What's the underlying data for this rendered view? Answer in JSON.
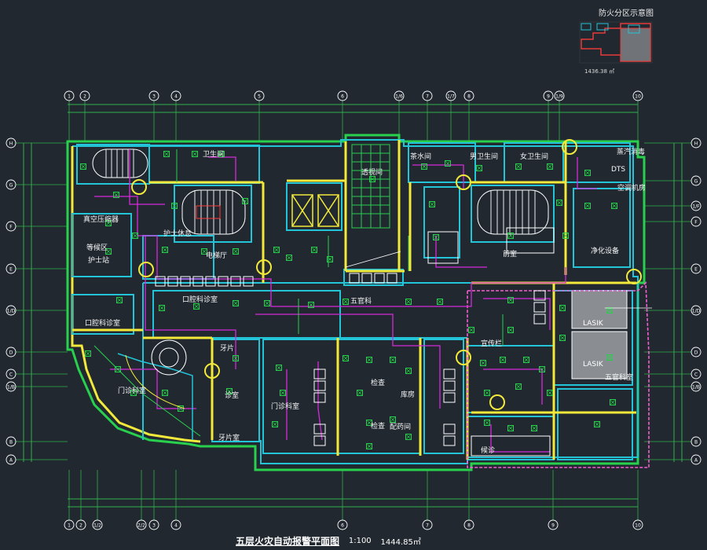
{
  "drawing": {
    "title": "五层火灾自动报警平面图",
    "scale": "1:100",
    "area": "1444.85㎡",
    "accent_colors": {
      "background": "#212830",
      "wall_cyan": "#23c4d8",
      "wall_yellow": "#f2e93a",
      "wire_magenta": "#d52ad9",
      "device_green": "#28d04e",
      "grid_green": "#31b14a",
      "fire_zone_pink": "#f35fd0"
    }
  },
  "inset": {
    "title": "防火分区示意图",
    "area_note": "1436.38 ㎡"
  },
  "grid_axes": {
    "top": [
      "1",
      "2",
      "3",
      "4",
      "5",
      "6",
      "1/6",
      "7",
      "1/7",
      "8",
      "9",
      "1/9",
      "10"
    ],
    "bottom": [
      "1",
      "2",
      "1/2",
      "2/2",
      "3",
      "4",
      "6",
      "7",
      "8",
      "9",
      "10"
    ],
    "left": [
      "H",
      "G",
      "F",
      "E",
      "1/D",
      "D",
      "C",
      "1/B",
      "B",
      "A"
    ],
    "right": [
      "H",
      "G",
      "1/F",
      "F",
      "E",
      "1/D",
      "D",
      "C",
      "1/B",
      "B",
      "A"
    ]
  },
  "rooms": [
    {
      "id": "r1",
      "label": "护士休息"
    },
    {
      "id": "r2",
      "label": "真空压缩器"
    },
    {
      "id": "r3",
      "label": "茶水间"
    },
    {
      "id": "r4",
      "label": "男卫生间"
    },
    {
      "id": "r5",
      "label": "女卫生间"
    },
    {
      "id": "r6",
      "label": "透视间"
    },
    {
      "id": "r7",
      "label": "蒸汽消毒"
    },
    {
      "id": "r8",
      "label": "空调机房"
    },
    {
      "id": "r9",
      "label": "护士站"
    },
    {
      "id": "r10",
      "label": "净化设备"
    },
    {
      "id": "r11",
      "label": "等候区"
    },
    {
      "id": "r12",
      "label": "口腔科诊室"
    },
    {
      "id": "r13",
      "label": "口腔科诊室"
    },
    {
      "id": "r14",
      "label": "五官科"
    },
    {
      "id": "r15",
      "label": "门诊科室"
    },
    {
      "id": "r16",
      "label": "牙片"
    },
    {
      "id": "r17",
      "label": "牙片室"
    },
    {
      "id": "r18",
      "label": "门诊科室"
    },
    {
      "id": "r19",
      "label": "宣传栏"
    },
    {
      "id": "r20",
      "label": "五官科室"
    },
    {
      "id": "r21",
      "label": "卫生间"
    },
    {
      "id": "r22",
      "label": "诊室"
    },
    {
      "id": "r23",
      "label": "LASIK"
    },
    {
      "id": "r24",
      "label": "LASIK"
    },
    {
      "id": "r25",
      "label": "电梯厅"
    },
    {
      "id": "r26",
      "label": "前室"
    },
    {
      "id": "r27",
      "label": "检查"
    },
    {
      "id": "r28",
      "label": "检查"
    },
    {
      "id": "r29",
      "label": "库房"
    },
    {
      "id": "r30",
      "label": "配药间"
    },
    {
      "id": "r31",
      "label": "候诊"
    },
    {
      "id": "r32",
      "label": "DTS"
    }
  ]
}
